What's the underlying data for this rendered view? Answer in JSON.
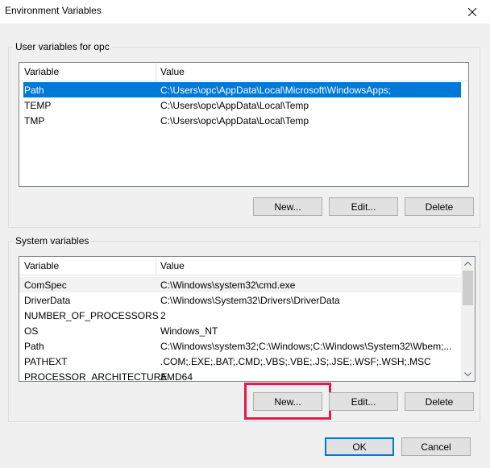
{
  "window": {
    "title": "Environment Variables"
  },
  "user_group": {
    "label": "User variables for opc",
    "headers": [
      "Variable",
      "Value"
    ],
    "rows": [
      {
        "variable": "Path",
        "value": "C:\\Users\\opc\\AppData\\Local\\Microsoft\\WindowsApps;"
      },
      {
        "variable": "TEMP",
        "value": "C:\\Users\\opc\\AppData\\Local\\Temp"
      },
      {
        "variable": "TMP",
        "value": "C:\\Users\\opc\\AppData\\Local\\Temp"
      }
    ],
    "new_label": "New...",
    "edit_label": "Edit...",
    "delete_label": "Delete"
  },
  "system_group": {
    "label": "System variables",
    "headers": [
      "Variable",
      "Value"
    ],
    "rows": [
      {
        "variable": "ComSpec",
        "value": "C:\\Windows\\system32\\cmd.exe"
      },
      {
        "variable": "DriverData",
        "value": "C:\\Windows\\System32\\Drivers\\DriverData"
      },
      {
        "variable": "NUMBER_OF_PROCESSORS",
        "value": "2"
      },
      {
        "variable": "OS",
        "value": "Windows_NT"
      },
      {
        "variable": "Path",
        "value": "C:\\Windows\\system32;C:\\Windows;C:\\Windows\\System32\\Wbem;..."
      },
      {
        "variable": "PATHEXT",
        "value": ".COM;.EXE;.BAT;.CMD;.VBS;.VBE;.JS;.JSE;.WSF;.WSH;.MSC"
      },
      {
        "variable": "PROCESSOR_ARCHITECTURE",
        "value": "AMD64"
      }
    ],
    "new_label": "New...",
    "edit_label": "Edit...",
    "delete_label": "Delete"
  },
  "footer": {
    "ok_label": "OK",
    "cancel_label": "Cancel"
  },
  "icons": {
    "close": "close-icon",
    "scroll_up": "chevron-up-icon",
    "scroll_down": "chevron-down-icon"
  },
  "colors": {
    "selection": "#0078d7",
    "highlight": "#e8194a",
    "default_border": "#0078d7"
  }
}
